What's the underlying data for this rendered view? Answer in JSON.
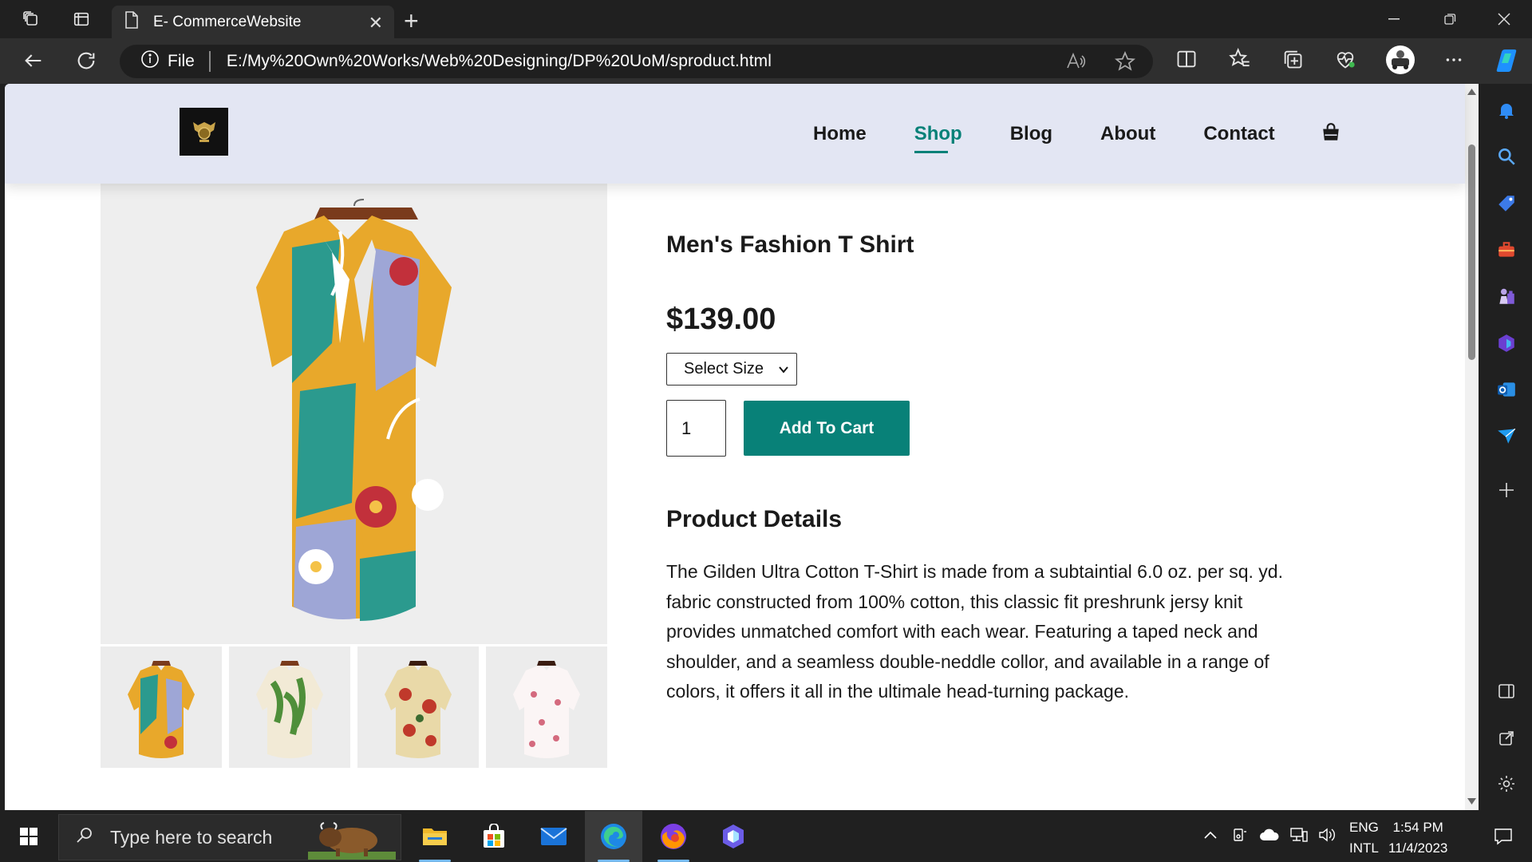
{
  "browser": {
    "tab_title": "E- CommerceWebsite",
    "address_prefix": "File",
    "url": "E:/My%20Own%20Works/Web%20Designing/DP%20UoM/sproduct.html"
  },
  "site": {
    "nav": [
      {
        "label": "Home",
        "active": false
      },
      {
        "label": "Shop",
        "active": true
      },
      {
        "label": "Blog",
        "active": false
      },
      {
        "label": "About",
        "active": false
      },
      {
        "label": "Contact",
        "active": false
      }
    ],
    "accent_color": "#088178",
    "header_bg": "#e3e6f3"
  },
  "product": {
    "title": "Men's Fashion T Shirt",
    "price": "$139.00",
    "size_select": "Select Size",
    "quantity": "1",
    "add_to_cart": "Add To Cart",
    "details_heading": "Product Details",
    "description": "The Gilden Ultra Cotton T-Shirt is made from a subtaintial 6.0 oz. per sq. yd. fabric constructed from 100% cotton, this classic fit preshrunk jersy knit provides unmatched comfort with each wear. Featuring a taped neck and shoulder, and a seamless double-neddle collor, and available in a range of colors, it offers it all in the ultimale head-turning package."
  },
  "taskbar": {
    "search_placeholder": "Type here to search",
    "lang_top": "ENG",
    "lang_bottom": "INTL",
    "time": "1:54 PM",
    "date": "11/4/2023"
  }
}
